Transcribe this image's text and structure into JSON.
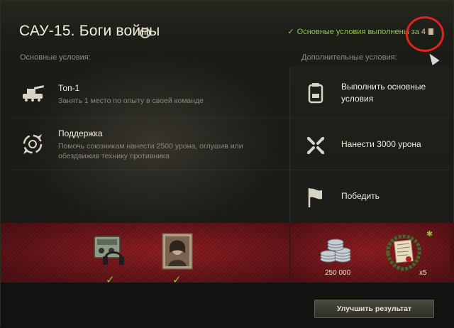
{
  "header": {
    "title": "САУ-15. Боги войны",
    "info_icon": "info-icon",
    "status_text": "Основные условия выполнены",
    "status_reward_prefix": "за",
    "status_reward_count": "4",
    "status_color": "#8ec348"
  },
  "main_conditions": {
    "label": "Основные условия:",
    "items": [
      {
        "icon": "artillery-icon",
        "title": "Топ-1",
        "description": "Занять 1 место по опыту в своей команде"
      },
      {
        "icon": "support-icon",
        "title": "Поддержка",
        "description": "Помочь союзникам нанести 2500 урона, оглушив или обездвижив технику противника"
      }
    ]
  },
  "extra_conditions": {
    "label": "Дополнительные условия:",
    "items": [
      {
        "icon": "checklist-icon",
        "text": "Выполнить основные условия"
      },
      {
        "icon": "crossed-shells-icon",
        "text": "Нанести 3000 урона"
      },
      {
        "icon": "flag-icon",
        "text": "Победить"
      }
    ]
  },
  "rewards": {
    "main": [
      {
        "icon": "radio-headset-icon",
        "received": true
      },
      {
        "icon": "portrait-icon",
        "received": true
      }
    ],
    "extra": [
      {
        "icon": "silver-coins-icon",
        "amount": "250 000"
      },
      {
        "icon": "commendation-scroll-icon",
        "amount": "x5"
      }
    ],
    "accent_color": "#8e1b20"
  },
  "actions": {
    "improve_label": "Улучшить результат"
  }
}
